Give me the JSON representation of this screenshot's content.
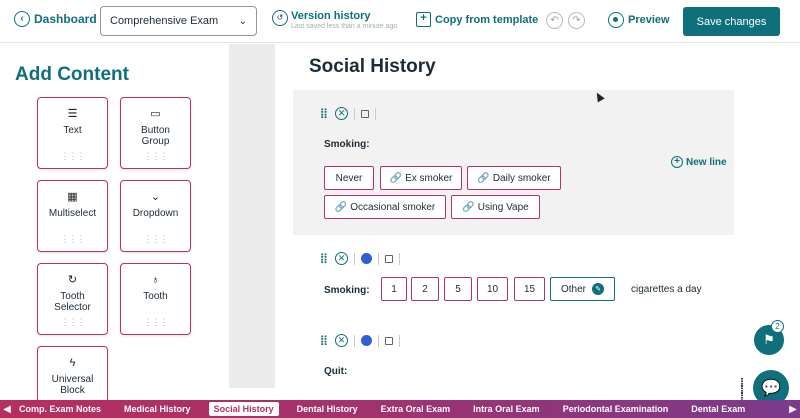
{
  "header": {
    "back_label": "Dashboard",
    "exam_select": "Comprehensive Exam",
    "version_history": "Version history",
    "last_saved": "Last saved less than a minute ago",
    "copy_template": "Copy from template",
    "preview": "Preview",
    "save": "Save changes"
  },
  "sidebar": {
    "title": "Add Content",
    "tiles": [
      {
        "label": "Text",
        "icon": "text-lines-icon"
      },
      {
        "label": "Button\nGroup",
        "icon": "button-group-icon"
      },
      {
        "label": "Multiselect",
        "icon": "multiselect-icon"
      },
      {
        "label": "Dropdown",
        "icon": "chevron-down-icon"
      },
      {
        "label": "Tooth\nSelector",
        "icon": "refresh-icon"
      },
      {
        "label": "Tooth",
        "icon": "tooth-icon"
      },
      {
        "label": "Universal\nBlock",
        "icon": "lightning-icon"
      }
    ]
  },
  "section": {
    "title": "Social History",
    "block1": {
      "label": "Smoking:",
      "new_line": "New line",
      "options": [
        "Never",
        "Ex smoker",
        "Daily smoker",
        "Occasional smoker",
        "Using Vape"
      ]
    },
    "block2": {
      "label": "Smoking:",
      "options": [
        "1",
        "2",
        "5",
        "10",
        "15"
      ],
      "other": "Other",
      "suffix": "cigarettes a day"
    },
    "block3": {
      "label": "Quit:"
    }
  },
  "notifications": {
    "count": "2"
  },
  "tabs": {
    "items": [
      "Comp. Exam Notes",
      "Medical History",
      "Social History",
      "Dental History",
      "Extra Oral Exam",
      "Intra Oral Exam",
      "Periodontal Examination",
      "Dental Exam"
    ],
    "active": "Social History"
  },
  "colors": {
    "accent": "#0f6f7a",
    "magenta": "#b0336a"
  }
}
